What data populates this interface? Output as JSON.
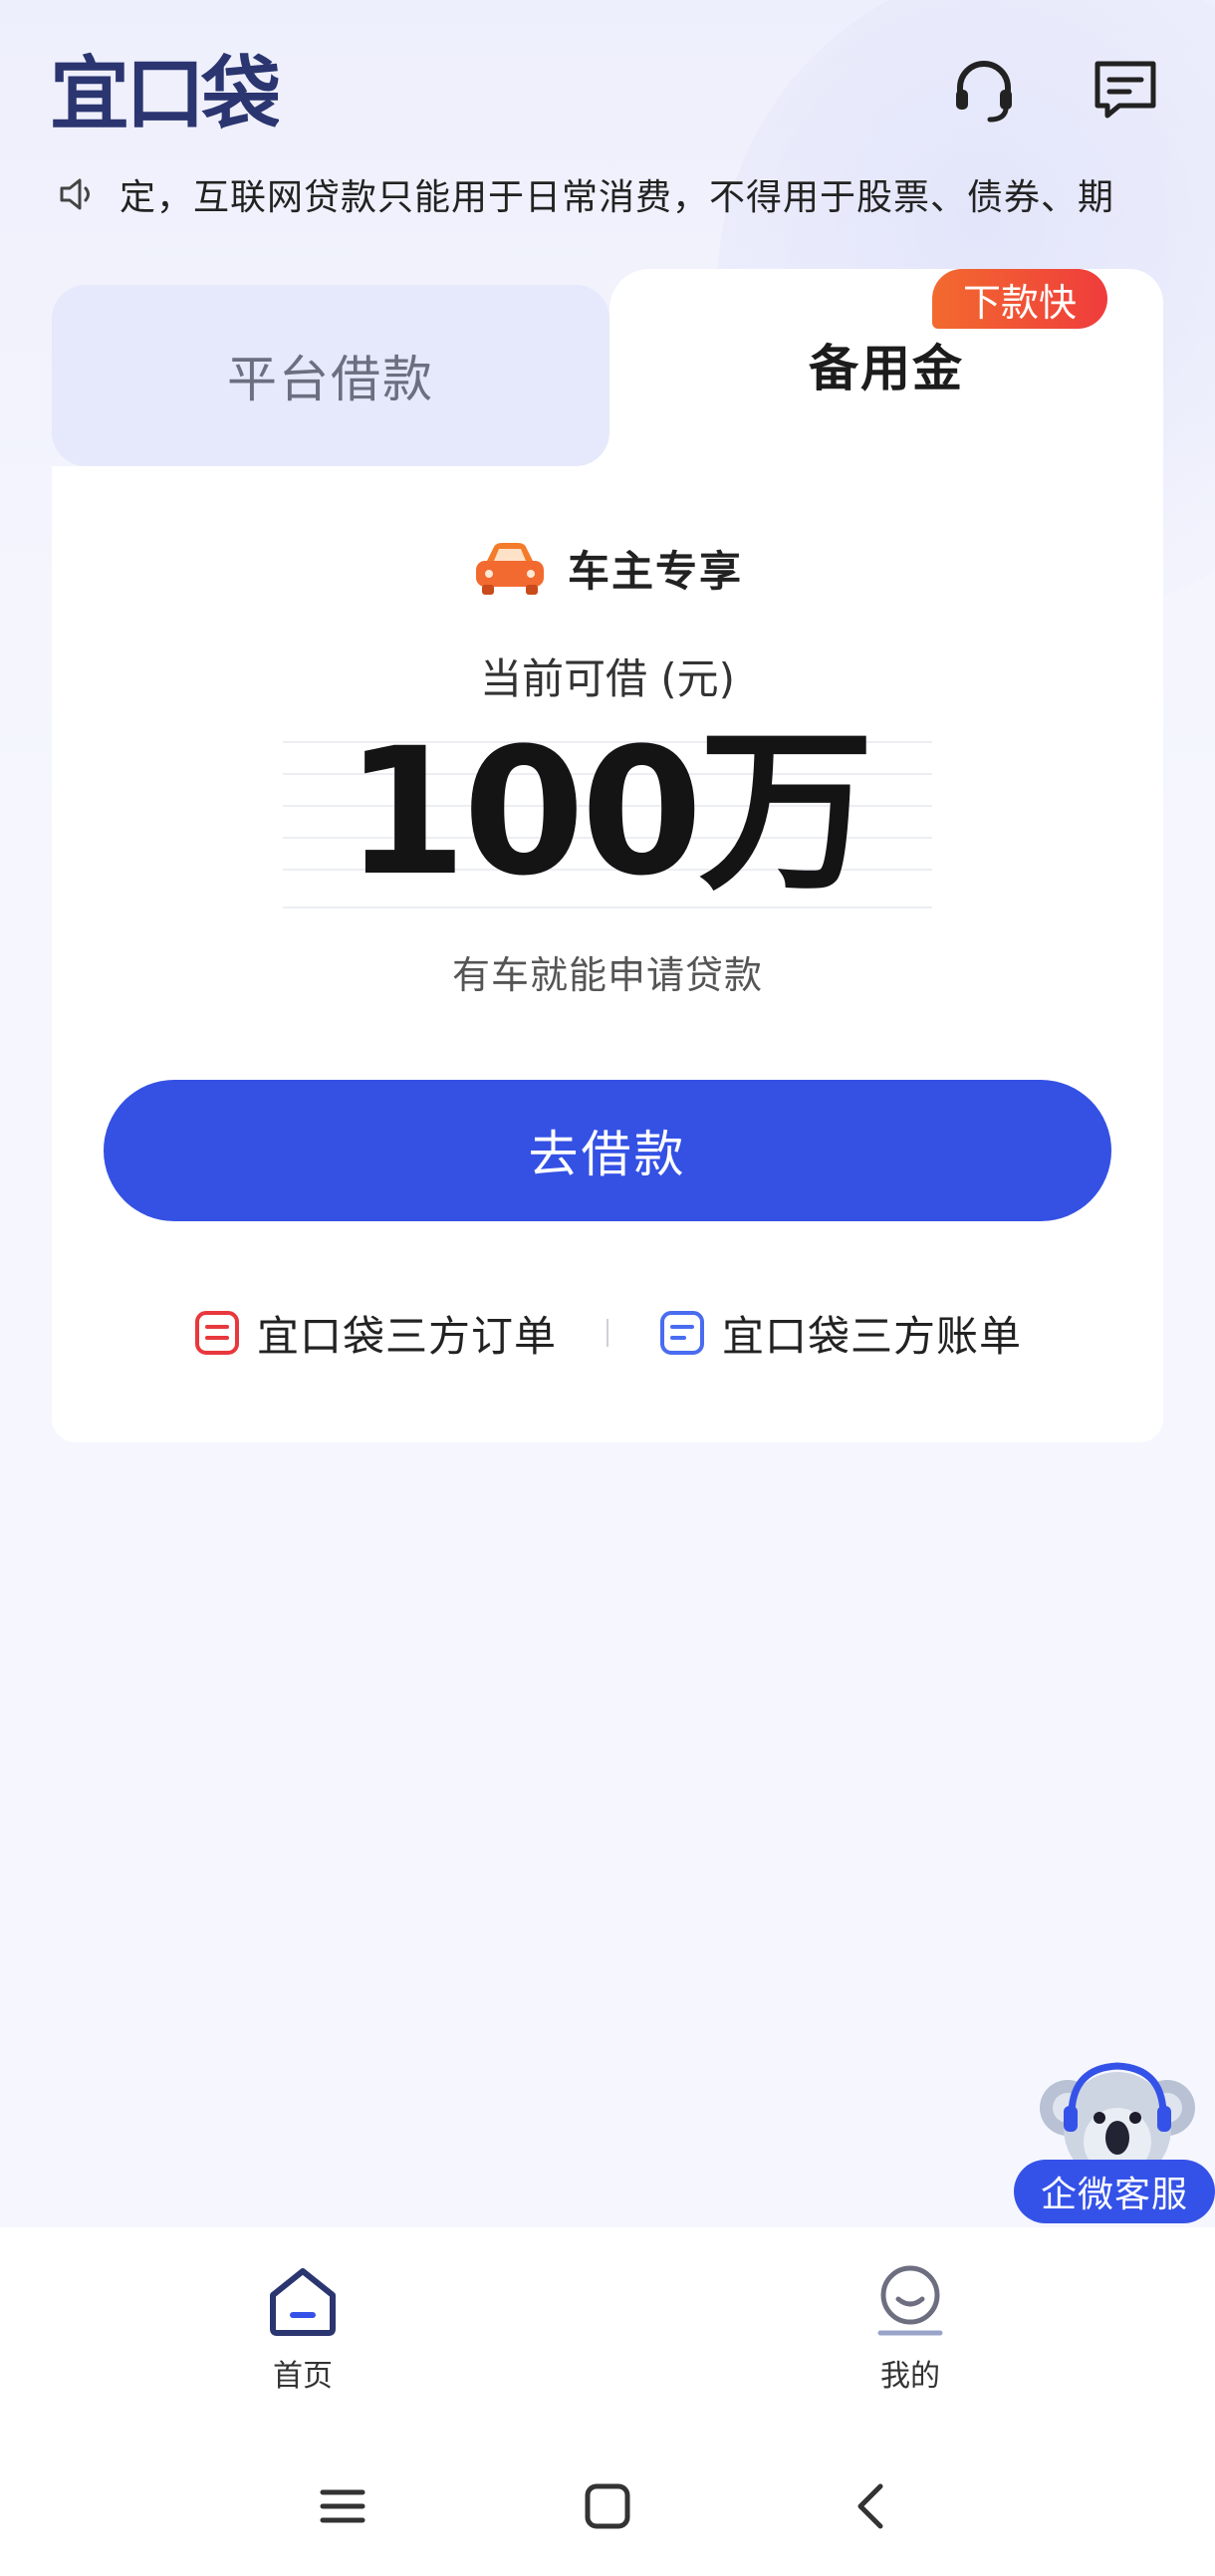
{
  "app": {
    "logo_text": "宜口袋"
  },
  "header": {
    "support_icon": "headset-icon",
    "message_icon": "message-icon"
  },
  "notice": {
    "icon": "speaker-icon",
    "text": "定，互联网贷款只能用于日常消费，不得用于股票、债券、期"
  },
  "tabs": [
    {
      "label": "平台借款",
      "active": false
    },
    {
      "label": "备用金",
      "active": true,
      "badge": "下款快"
    }
  ],
  "card": {
    "tag": "车主专享",
    "tag_icon": "car-icon",
    "amount_label": "当前可借 (元)",
    "amount": "100万",
    "subtitle": "有车就能申请贷款",
    "button_label": "去借款",
    "links": [
      {
        "label": "宜口袋三方订单",
        "icon": "order-icon",
        "color": "#e8383d"
      },
      {
        "label": "宜口袋三方账单",
        "icon": "bill-icon",
        "color": "#4a6cf0"
      }
    ]
  },
  "float_support": {
    "label": "企微客服",
    "icon": "koala-mascot-icon"
  },
  "bottom_nav": [
    {
      "label": "首页",
      "icon": "home-icon",
      "active": true
    },
    {
      "label": "我的",
      "icon": "profile-icon",
      "active": false
    }
  ],
  "system_nav": {
    "menu_icon": "menu-icon",
    "home_icon": "square-home-icon",
    "back_icon": "back-icon"
  },
  "colors": {
    "primary": "#3451e4",
    "badge_start": "#f26a2f",
    "badge_end": "#ef3c3c",
    "logo": "#2b3570"
  }
}
